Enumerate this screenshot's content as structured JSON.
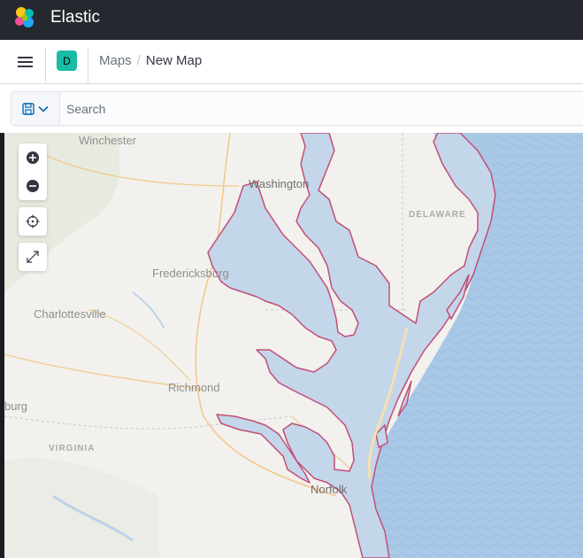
{
  "app": {
    "brand": "Elastic"
  },
  "header": {
    "space_initial": "D",
    "breadcrumbs": [
      {
        "label": "Maps"
      },
      {
        "label": "New Map"
      }
    ],
    "breadcrumb_separator": "/"
  },
  "query_bar": {
    "search_placeholder": "Search"
  },
  "map": {
    "labels": {
      "winchester": "Winchester",
      "washington": "Washington",
      "delaware": "DELAWARE",
      "fredericksburg": "Fredericksburg",
      "charlottesville": "Charlottesville",
      "richmond": "Richmond",
      "burg": "burg",
      "virginia": "VIRGINIA",
      "norfolk": "Norfolk"
    },
    "colors": {
      "land": "#f2f1ee",
      "water": "#b9d3ea",
      "ocean": "#a9c8e6",
      "feature_fill": "#c3d6ea",
      "feature_stroke": "#c24e78",
      "road": "#f4c98b"
    }
  }
}
